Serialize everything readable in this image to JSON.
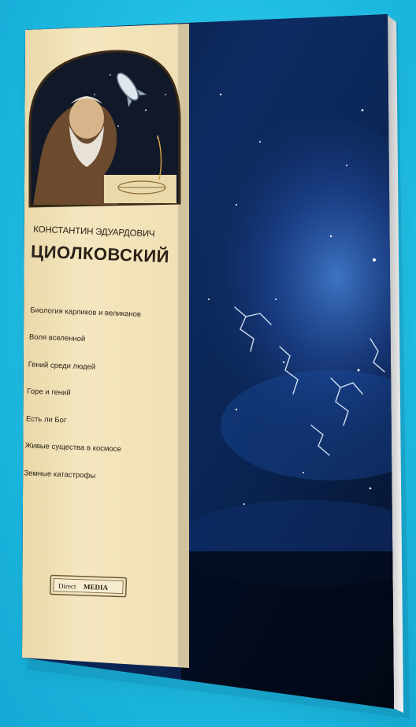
{
  "book": {
    "author_first": "КОНСТАНТИН ЭДУАРДОВИЧ",
    "author_last": "ЦИОЛКОВСКИЙ",
    "titles": [
      "Биология карликов и великанов",
      "Воля вселенной",
      "Гений среди людей",
      "Горе и гений",
      "Есть ли Бог",
      "Живые существа в космосе",
      "Земные катастрофы"
    ],
    "publisher": {
      "part1": "Direct",
      "part2": "MEDIA"
    }
  },
  "colors": {
    "background": "#22bfe4",
    "cover_panel": "#f2e4bd",
    "space": "#0b1a3a",
    "lightning": "#e6f2ff"
  },
  "icons": {
    "portrait": "portrait-illustration",
    "rocket": "rocket-icon",
    "logo": "publisher-logo"
  }
}
